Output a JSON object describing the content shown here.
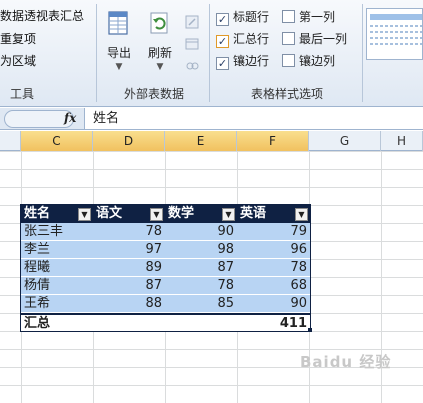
{
  "ribbon": {
    "tools_group": {
      "items": [
        "数据透视表汇总",
        "重复项",
        "为区域"
      ],
      "label": "工具"
    },
    "external_group": {
      "export_label": "导出",
      "refresh_label": "刷新",
      "label": "外部表数据"
    },
    "style_options": {
      "label": "表格样式选项",
      "options": [
        {
          "label": "标题行",
          "checked": true
        },
        {
          "label": "第一列",
          "checked": false
        },
        {
          "label": "汇总行",
          "checked": true
        },
        {
          "label": "最后一列",
          "checked": false
        },
        {
          "label": "镶边行",
          "checked": true
        },
        {
          "label": "镶边列",
          "checked": false
        }
      ]
    }
  },
  "formula_bar": {
    "fx_label": "fx",
    "value": "姓名"
  },
  "columns": [
    "C",
    "D",
    "E",
    "F",
    "G",
    "H"
  ],
  "selected_columns": [
    "C",
    "D",
    "E",
    "F"
  ],
  "table": {
    "headers": [
      "姓名",
      "语文",
      "数学",
      "英语"
    ],
    "rows": [
      [
        "张三丰",
        "78",
        "90",
        "79"
      ],
      [
        "李兰",
        "97",
        "98",
        "96"
      ],
      [
        "程曦",
        "89",
        "87",
        "78"
      ],
      [
        "杨倩",
        "87",
        "78",
        "68"
      ],
      [
        "王希",
        "88",
        "85",
        "90"
      ]
    ],
    "total_label": "汇总",
    "total_value": "411"
  },
  "colors": {
    "header_bg": "#0f2143",
    "band_bg": "#b8d4f3",
    "selected_col_header": "#f1c15f"
  },
  "watermark": "Baidu 经验"
}
